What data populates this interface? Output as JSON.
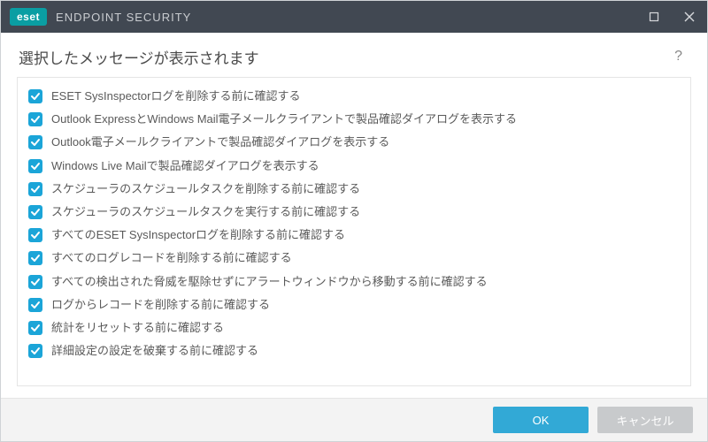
{
  "titlebar": {
    "brand_badge": "eset",
    "brand_name": "ENDPOINT SECURITY"
  },
  "header": {
    "title": "選択したメッセージが表示されます",
    "help": "?"
  },
  "checklist": [
    {
      "checked": true,
      "label": "ESET SysInspectorログを削除する前に確認する"
    },
    {
      "checked": true,
      "label": "Outlook ExpressとWindows Mail電子メールクライアントで製品確認ダイアログを表示する"
    },
    {
      "checked": true,
      "label": "Outlook電子メールクライアントで製品確認ダイアログを表示する"
    },
    {
      "checked": true,
      "label": "Windows Live Mailで製品確認ダイアログを表示する"
    },
    {
      "checked": true,
      "label": "スケジューラのスケジュールタスクを削除する前に確認する"
    },
    {
      "checked": true,
      "label": "スケジューラのスケジュールタスクを実行する前に確認する"
    },
    {
      "checked": true,
      "label": "すべてのESET SysInspectorログを削除する前に確認する"
    },
    {
      "checked": true,
      "label": "すべてのログレコードを削除する前に確認する"
    },
    {
      "checked": true,
      "label": "すべての検出された脅威を駆除せずにアラートウィンドウから移動する前に確認する"
    },
    {
      "checked": true,
      "label": "ログからレコードを削除する前に確認する"
    },
    {
      "checked": true,
      "label": "統計をリセットする前に確認する"
    },
    {
      "checked": true,
      "label": "詳細設定の設定を破棄する前に確認する"
    }
  ],
  "footer": {
    "ok_label": "OK",
    "cancel_label": "キャンセル"
  }
}
